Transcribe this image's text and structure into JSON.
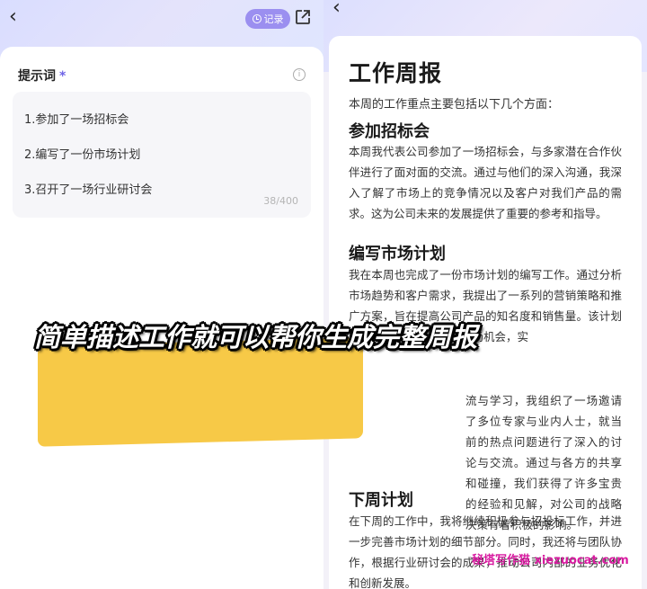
{
  "left_screen": {
    "record_label": "记录",
    "prompt_label": "提示词",
    "required_mark": "*",
    "info_icon_text": "i",
    "prompt_lines": [
      "1.参加了一场招标会",
      "2.编写了一份市场计划",
      "3.召开了一场行业研讨会"
    ],
    "char_counter": "38/400"
  },
  "right_screen": {
    "title": "工作周报",
    "intro": "本周的工作重点主要包括以下几个方面：",
    "sections": [
      {
        "heading": "参加招标会",
        "body": "本周我代表公司参加了一场招标会，与多家潜在合作伙伴进行了面对面的交流。通过与他们的深入沟通，我深入了解了市场上的竞争情况以及客户对我们产品的需求。这为公司未来的发展提供了重要的参考和指导。"
      },
      {
        "heading": "编写市场计划",
        "body": "我在本周也完成了一份市场计划的编写工作。通过分析市场趋势和客户需求，我提出了一系列的营销策略和推广方案，旨在提高公司产品的知名度和销售量。该计划将帮助我们更好地掌握市场机会，实"
      },
      {
        "heading": "",
        "body": "流与学习，我组织了一场邀请了多位专家与业内人士，就当前的热点问题进行了深入的讨论与交流。通过与各方的共享和碰撞，我们获得了许多宝贵的经验和见解，对公司的战略决策有着积极的影响。"
      },
      {
        "heading": "下周计划",
        "body": "在下周的工作中，我将继续积极参与招投标工作，并进一步完善市场计划的细节部分。同时，我还将与团队协作，根据行业研讨会的成果，推动公司内部的业务优化和创新发展。"
      }
    ]
  },
  "overlay": {
    "caption": "简单描述工作就可以帮你生成完整周报",
    "highlight_color": "#f7c741",
    "watermark": "秘塔写作猫  xiezuocat.com"
  },
  "colors": {
    "accent": "#6e63e6",
    "record_button": "#9b8ff0"
  }
}
